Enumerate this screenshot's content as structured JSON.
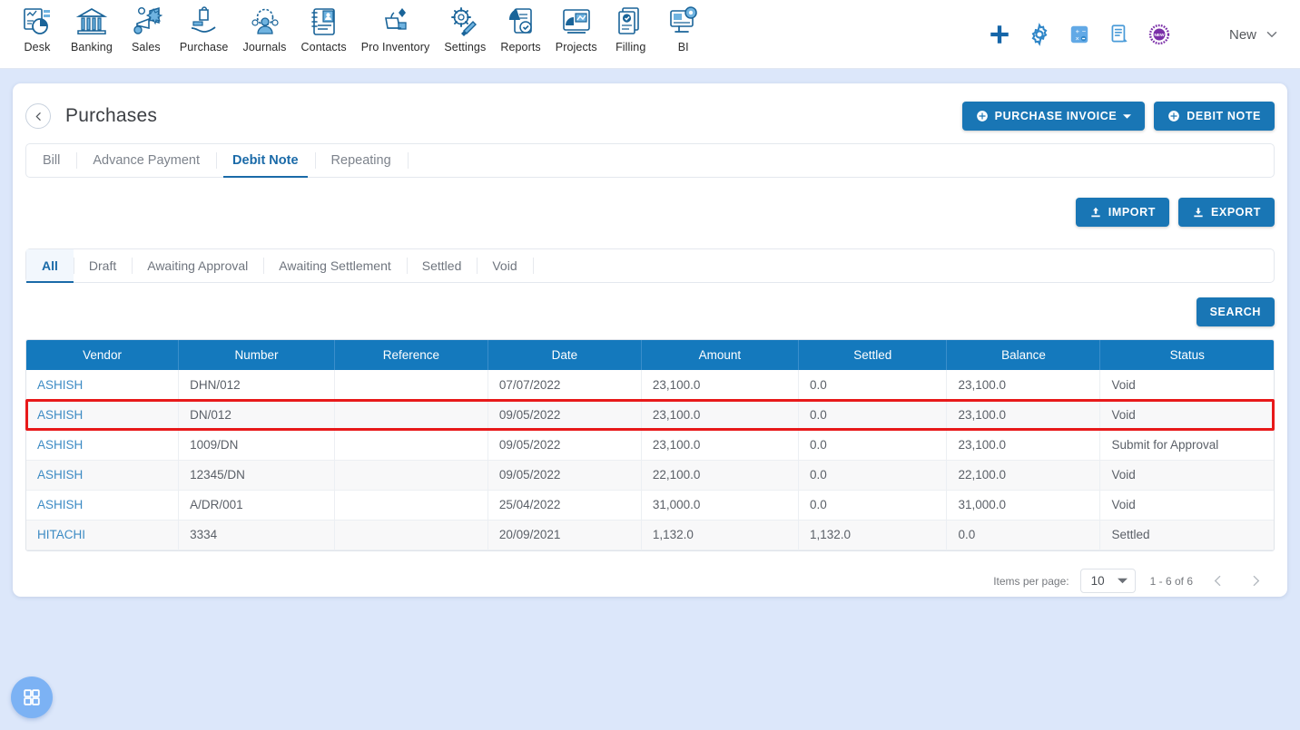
{
  "topnav": {
    "modules": [
      {
        "label": "Desk",
        "icon": "desk-dashboard-icon"
      },
      {
        "label": "Banking",
        "icon": "bank-building-icon"
      },
      {
        "label": "Sales",
        "icon": "megaphone-sales-icon"
      },
      {
        "label": "Purchase",
        "icon": "purchase-bag-hand-icon"
      },
      {
        "label": "Journals",
        "icon": "journals-people-gear-icon"
      },
      {
        "label": "Contacts",
        "icon": "contacts-address-book-icon"
      },
      {
        "label": "Pro Inventory",
        "icon": "inventory-cart-icon"
      },
      {
        "label": "Settings",
        "icon": "settings-gear-wrench-icon"
      },
      {
        "label": "Reports",
        "icon": "reports-piechart-icon"
      },
      {
        "label": "Projects",
        "icon": "projects-board-icon"
      },
      {
        "label": "Filling",
        "icon": "filling-documents-check-icon"
      },
      {
        "label": "BI",
        "icon": "bi-monitor-gear-icon"
      }
    ],
    "tools": [
      {
        "name": "add-plus-icon",
        "color": "#1565a8"
      },
      {
        "name": "gear-icon",
        "color": "#2f86c8"
      },
      {
        "name": "calculator-icon",
        "color": "#62a9e6"
      },
      {
        "name": "notes-icon",
        "color": "#4a9bd8"
      },
      {
        "name": "new-badge-icon",
        "color": "#7b2fa8"
      }
    ],
    "user_name": "New"
  },
  "page": {
    "title": "Purchases",
    "back_icon": "chevron-left-icon",
    "actions": [
      {
        "label": "PURCHASE INVOICE",
        "icon": "plus-circle-icon",
        "caret": true
      },
      {
        "label": "DEBIT NOTE",
        "icon": "plus-circle-icon",
        "caret": false
      }
    ]
  },
  "doc_tabs": [
    {
      "label": "Bill",
      "active": false
    },
    {
      "label": "Advance Payment",
      "active": false
    },
    {
      "label": "Debit Note",
      "active": true
    },
    {
      "label": "Repeating",
      "active": false
    }
  ],
  "io_buttons": [
    {
      "label": "IMPORT",
      "icon": "upload-icon"
    },
    {
      "label": "EXPORT",
      "icon": "download-icon"
    }
  ],
  "status_tabs": [
    {
      "label": "All",
      "active": true
    },
    {
      "label": "Draft",
      "active": false
    },
    {
      "label": "Awaiting Approval",
      "active": false
    },
    {
      "label": "Awaiting Settlement",
      "active": false
    },
    {
      "label": "Settled",
      "active": false
    },
    {
      "label": "Void",
      "active": false
    }
  ],
  "search": {
    "label": "SEARCH"
  },
  "table": {
    "columns": [
      "Vendor",
      "Number",
      "Reference",
      "Date",
      "Amount",
      "Settled",
      "Balance",
      "Status"
    ],
    "rows": [
      {
        "vendor": "ASHISH",
        "number": "DHN/012",
        "reference": "",
        "date": "07/07/2022",
        "amount": "23,100.0",
        "settled": "0.0",
        "balance": "23,100.0",
        "status": "Void",
        "highlighted": false
      },
      {
        "vendor": "ASHISH",
        "number": "DN/012",
        "reference": "",
        "date": "09/05/2022",
        "amount": "23,100.0",
        "settled": "0.0",
        "balance": "23,100.0",
        "status": "Void",
        "highlighted": true
      },
      {
        "vendor": "ASHISH",
        "number": "1009/DN",
        "reference": "",
        "date": "09/05/2022",
        "amount": "23,100.0",
        "settled": "0.0",
        "balance": "23,100.0",
        "status": "Submit for Approval",
        "highlighted": false
      },
      {
        "vendor": "ASHISH",
        "number": "12345/DN",
        "reference": "",
        "date": "09/05/2022",
        "amount": "22,100.0",
        "settled": "0.0",
        "balance": "22,100.0",
        "status": "Void",
        "highlighted": false
      },
      {
        "vendor": "ASHISH",
        "number": "A/DR/001",
        "reference": "",
        "date": "25/04/2022",
        "amount": "31,000.0",
        "settled": "0.0",
        "balance": "31,000.0",
        "status": "Void",
        "highlighted": false
      },
      {
        "vendor": "HITACHI",
        "number": "3334",
        "reference": "",
        "date": "20/09/2021",
        "amount": "1,132.0",
        "settled": "1,132.0",
        "balance": "0.0",
        "status": "Settled",
        "highlighted": false
      }
    ]
  },
  "pagination": {
    "items_per_page_label": "Items per page:",
    "items_per_page_value": "10",
    "range": "1 - 6 of 6",
    "prev_icon": "chevron-left-icon",
    "next_icon": "chevron-right-icon"
  },
  "fab": {
    "icon": "apps-grid-icon"
  },
  "colors": {
    "accent_blue": "#1479bd",
    "page_bg": "#dce7fa",
    "highlight_red": "#e8191a",
    "link_blue": "#3d8bc4"
  }
}
